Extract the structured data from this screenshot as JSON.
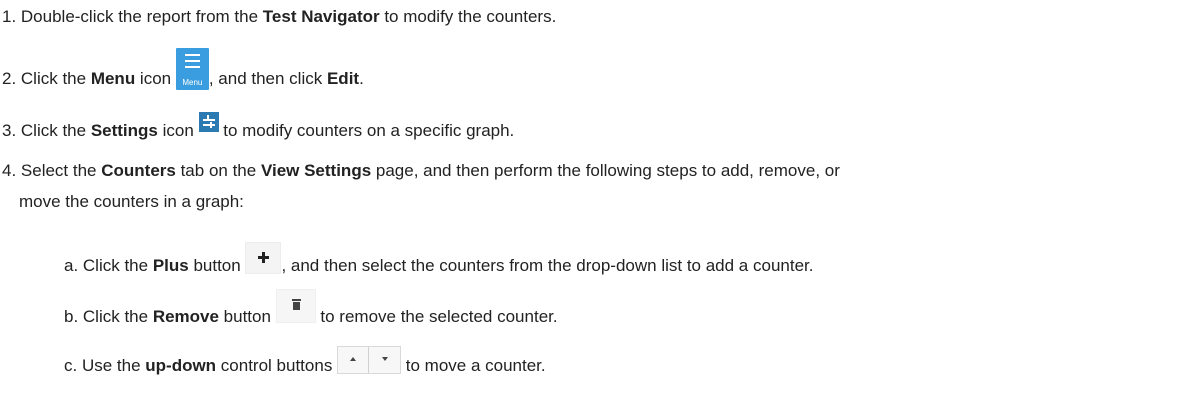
{
  "steps": {
    "s1": {
      "pre": "1. Double-click the report from the ",
      "b1": "Test Navigator",
      "post": " to modify the counters."
    },
    "s2": {
      "pre": "2. Click the ",
      "b1": "Menu",
      "mid1": " icon ",
      "mid2": ", and then click ",
      "b2": "Edit",
      "post": "."
    },
    "s3": {
      "pre": "3. Click the ",
      "b1": "Settings",
      "mid1": " icon ",
      "post": " to modify counters on a specific graph."
    },
    "s4": {
      "pre": "4. Select the ",
      "b1": "Counters",
      "mid1": " tab on the ",
      "b2": "View Settings",
      "post": " page, and then perform the following steps to add, remove, or",
      "cont": "move the counters in a graph:"
    }
  },
  "substeps": {
    "a": {
      "pre": "a. Click the ",
      "b1": "Plus",
      "mid1": " button ",
      "post": ", and then select the counters from the drop-down list to add a counter."
    },
    "b": {
      "pre": "b. Click the ",
      "b1": "Remove",
      "mid1": " button ",
      "post": " to remove the selected counter."
    },
    "c": {
      "pre": "c. Use the ",
      "b1": "up-down",
      "mid1": " control buttons ",
      "post": " to move a counter."
    }
  },
  "icons": {
    "menu_caption": "Menu",
    "menu_color": "#3a9ddf",
    "settings_color": "#2b7ab1"
  }
}
